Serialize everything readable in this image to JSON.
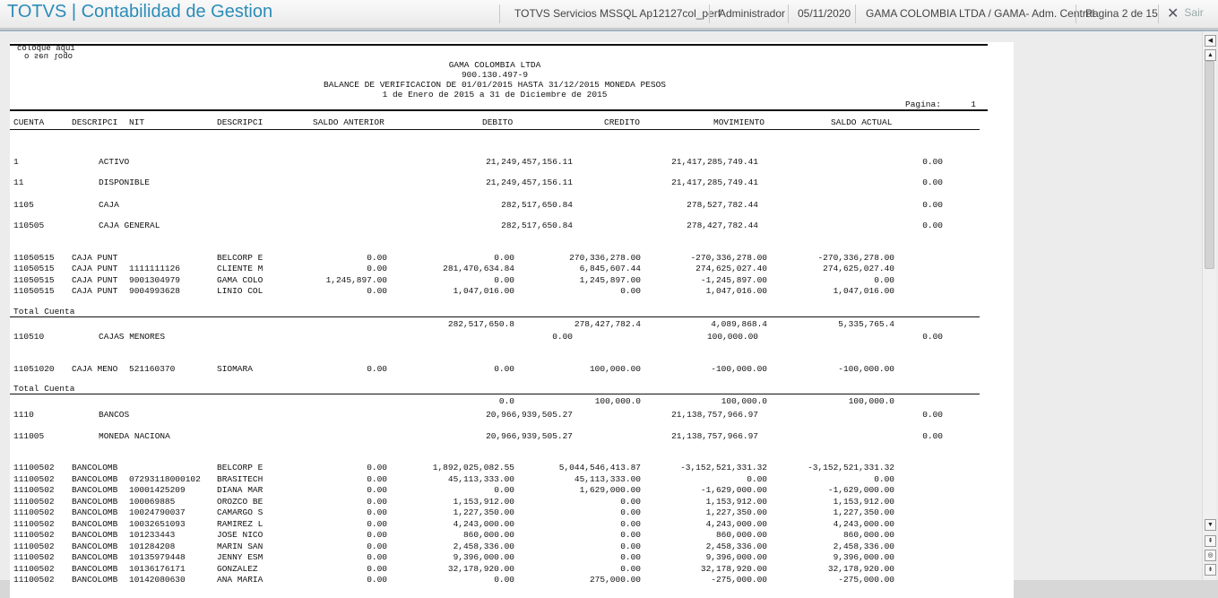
{
  "header": {
    "title": "TOTVS | Contabilidad de Gestion",
    "items": [
      {
        "key": "environment",
        "text": "TOTVS Servicios MSSQL Ap12127col_perf"
      },
      {
        "key": "user",
        "text": "Administrador"
      },
      {
        "key": "date",
        "text": "05/11/2020"
      },
      {
        "key": "company",
        "text": "GAMA COLOMBIA LTDA / GAMA- Adm. Central"
      },
      {
        "key": "page",
        "text": "Pagina 2 de 15"
      }
    ],
    "exit_label": "Sair",
    "exit_icon": "close-icon"
  },
  "report": {
    "logo_text": "coloque aqui o seu logo",
    "company": "GAMA COLOMBIA LTDA",
    "nit": "900.130.497-9",
    "title": "BALANCE DE VERIFICACION DE 01/01/2015 HASTA 31/12/2015 MONEDA PESOS",
    "period": "1 de Enero de 2015 a 31 de Diciembre de 2015",
    "page_label": "Pagina:",
    "page_number": "1",
    "columns": [
      "CUENTA",
      "DESCRIPCI",
      "NIT",
      "DESCRIPCI",
      "SALDO ANTERIOR",
      "DEBITO",
      "CREDITO",
      "MOVIMIENTO",
      "SALDO ACTUAL"
    ],
    "total_label": "Total Cuenta",
    "rows": [
      {
        "type": "account",
        "cuenta": "1",
        "desc": "ACTIVO",
        "debito": "21,249,457,156.11",
        "credito": "21,417,285,749.41",
        "actual": "0.00"
      },
      {
        "type": "account",
        "cuenta": "11",
        "desc": "DISPONIBLE",
        "debito": "21,249,457,156.11",
        "credito": "21,417,285,749.41",
        "actual": "0.00"
      },
      {
        "type": "account",
        "cuenta": "1105",
        "desc": "CAJA",
        "debito": "282,517,650.84",
        "credito": "278,527,782.44",
        "actual": "0.00"
      },
      {
        "type": "account",
        "cuenta": "110505",
        "desc": "CAJA GENERAL",
        "debito": "282,517,650.84",
        "credito": "278,427,782.44",
        "actual": "0.00"
      },
      {
        "type": "detail",
        "cuenta": "11050515",
        "desc": "CAJA PUNT",
        "nit": "",
        "desc2": "BELCORP E",
        "anterior": "0.00",
        "debito": "0.00",
        "credito": "270,336,278.00",
        "mov": "-270,336,278.00",
        "saldo": "-270,336,278.00"
      },
      {
        "type": "detail",
        "cuenta": "11050515",
        "desc": "CAJA PUNT",
        "nit": "1111111126",
        "desc2": "CLIENTE M",
        "anterior": "0.00",
        "debito": "281,470,634.84",
        "credito": "6,845,607.44",
        "mov": "274,625,027.40",
        "saldo": "274,625,027.40"
      },
      {
        "type": "detail",
        "cuenta": "11050515",
        "desc": "CAJA PUNT",
        "nit": "9001304979",
        "desc2": "GAMA COLO",
        "anterior": "1,245,897.00",
        "debito": "0.00",
        "credito": "1,245,897.00",
        "mov": "-1,245,897.00",
        "saldo": "0.00"
      },
      {
        "type": "detail",
        "cuenta": "11050515",
        "desc": "CAJA PUNT",
        "nit": "9004993628",
        "desc2": "LINIO COL",
        "anterior": "0.00",
        "debito": "1,047,016.00",
        "credito": "0.00",
        "mov": "1,047,016.00",
        "saldo": "1,047,016.00"
      },
      {
        "type": "total",
        "debito": "282,517,650.8",
        "credito": "278,427,782.4",
        "mov": "4,089,868.4",
        "saldo": "5,335,765.4"
      },
      {
        "type": "account",
        "cuenta": "110510",
        "desc": "CAJAS MENORES",
        "debito": "0.00",
        "credito": "100,000.00",
        "actual": "0.00"
      },
      {
        "type": "detail",
        "cuenta": "11051020",
        "desc": "CAJA MENO",
        "nit": "521160370",
        "desc2": "SIOMARA",
        "anterior": "0.00",
        "debito": "0.00",
        "credito": "100,000.00",
        "mov": "-100,000.00",
        "saldo": "-100,000.00"
      },
      {
        "type": "total",
        "debito": "0.0",
        "credito": "100,000.0",
        "mov": "100,000.0",
        "saldo": "100,000.0"
      },
      {
        "type": "account",
        "cuenta": "1110",
        "desc": "BANCOS",
        "debito": "20,966,939,505.27",
        "credito": "21,138,757,966.97",
        "actual": "0.00"
      },
      {
        "type": "account",
        "cuenta": "111005",
        "desc": "MONEDA NACIONA",
        "debito": "20,966,939,505.27",
        "credito": "21,138,757,966.97",
        "actual": "0.00"
      },
      {
        "type": "detail",
        "cuenta": "11100502",
        "desc": "BANCOLOMB",
        "nit": "",
        "desc2": "BELCORP E",
        "anterior": "0.00",
        "debito": "1,892,025,082.55",
        "credito": "5,044,546,413.87",
        "mov": "-3,152,521,331.32",
        "saldo": "-3,152,521,331.32"
      },
      {
        "type": "detail",
        "cuenta": "11100502",
        "desc": "BANCOLOMB",
        "nit": "07293118000102",
        "desc2": "BRASITECH",
        "anterior": "0.00",
        "debito": "45,113,333.00",
        "credito": "45,113,333.00",
        "mov": "0.00",
        "saldo": "0.00"
      },
      {
        "type": "detail",
        "cuenta": "11100502",
        "desc": "BANCOLOMB",
        "nit": "10001425209",
        "desc2": "DIANA MAR",
        "anterior": "0.00",
        "debito": "0.00",
        "credito": "1,629,000.00",
        "mov": "-1,629,000.00",
        "saldo": "-1,629,000.00"
      },
      {
        "type": "detail",
        "cuenta": "11100502",
        "desc": "BANCOLOMB",
        "nit": "100069885",
        "desc2": "OROZCO BE",
        "anterior": "0.00",
        "debito": "1,153,912.00",
        "credito": "0.00",
        "mov": "1,153,912.00",
        "saldo": "1,153,912.00"
      },
      {
        "type": "detail",
        "cuenta": "11100502",
        "desc": "BANCOLOMB",
        "nit": "10024790037",
        "desc2": "CAMARGO S",
        "anterior": "0.00",
        "debito": "1,227,350.00",
        "credito": "0.00",
        "mov": "1,227,350.00",
        "saldo": "1,227,350.00"
      },
      {
        "type": "detail",
        "cuenta": "11100502",
        "desc": "BANCOLOMB",
        "nit": "10032651093",
        "desc2": "RAMIREZ L",
        "anterior": "0.00",
        "debito": "4,243,000.00",
        "credito": "0.00",
        "mov": "4,243,000.00",
        "saldo": "4,243,000.00"
      },
      {
        "type": "detail",
        "cuenta": "11100502",
        "desc": "BANCOLOMB",
        "nit": "101233443",
        "desc2": "JOSE NICO",
        "anterior": "0.00",
        "debito": "860,000.00",
        "credito": "0.00",
        "mov": "860,000.00",
        "saldo": "860,000.00"
      },
      {
        "type": "detail",
        "cuenta": "11100502",
        "desc": "BANCOLOMB",
        "nit": "101284208",
        "desc2": "MARIN SAN",
        "anterior": "0.00",
        "debito": "2,458,336.00",
        "credito": "0.00",
        "mov": "2,458,336.00",
        "saldo": "2,458,336.00"
      },
      {
        "type": "detail",
        "cuenta": "11100502",
        "desc": "BANCOLOMB",
        "nit": "10135979448",
        "desc2": "JENNY ESM",
        "anterior": "0.00",
        "debito": "9,396,000.00",
        "credito": "0.00",
        "mov": "9,396,000.00",
        "saldo": "9,396,000.00"
      },
      {
        "type": "detail",
        "cuenta": "11100502",
        "desc": "BANCOLOMB",
        "nit": "10136176171",
        "desc2": "GONZALEZ",
        "anterior": "0.00",
        "debito": "32,178,920.00",
        "credito": "0.00",
        "mov": "32,178,920.00",
        "saldo": "32,178,920.00"
      },
      {
        "type": "detail",
        "cuenta": "11100502",
        "desc": "BANCOLOMB",
        "nit": "10142080630",
        "desc2": "ANA MARIA",
        "anterior": "0.00",
        "debito": "0.00",
        "credito": "275,000.00",
        "mov": "-275,000.00",
        "saldo": "-275,000.00"
      }
    ]
  }
}
